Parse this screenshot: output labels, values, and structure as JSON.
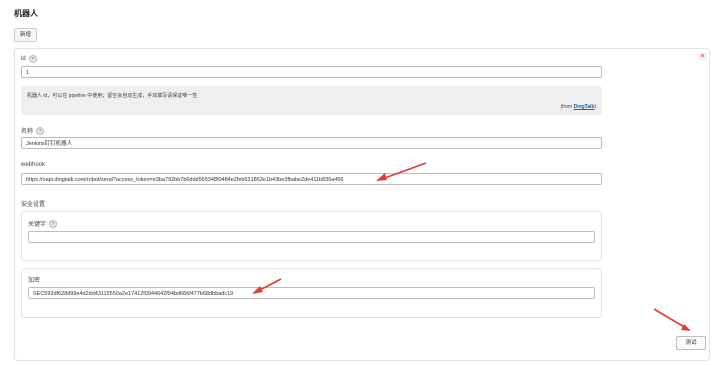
{
  "page": {
    "title": "机器人"
  },
  "toolbar": {
    "add_label": "新增"
  },
  "card": {
    "close_glyph": "×"
  },
  "fields": {
    "id": {
      "label": "id",
      "help": "?",
      "value": "1"
    },
    "info": {
      "text": "机器人 id，可以在 pipeline 中使用；留空会自动生成，手动填写请保证唯一性",
      "from_prefix": "(from ",
      "from_link": "DingTalk",
      "from_suffix": ")"
    },
    "name": {
      "label": "名称",
      "help": "?",
      "value": "Jenkins钉钉机器人"
    },
    "webhook": {
      "label": "webhook",
      "value": "https://oapi.dingtalk.com/robot/send?access_token=e3ba792bb7b6ddd565348f0484e2feb631863e1b43be3fbabe2de411b836a456"
    },
    "security": {
      "label": "安全设置",
      "keyword": {
        "label": "关键字",
        "help": "?",
        "value": ""
      },
      "sign": {
        "label": "加密",
        "value": "SEC593df628d99e4d2dd43115550a2e17412f0944642f94bd666f477b68dbbadc19"
      }
    }
  },
  "actions": {
    "test_label": "测试"
  },
  "colors": {
    "arrow": "#e53935",
    "close": "#d22222",
    "link": "#1a5fb4"
  }
}
